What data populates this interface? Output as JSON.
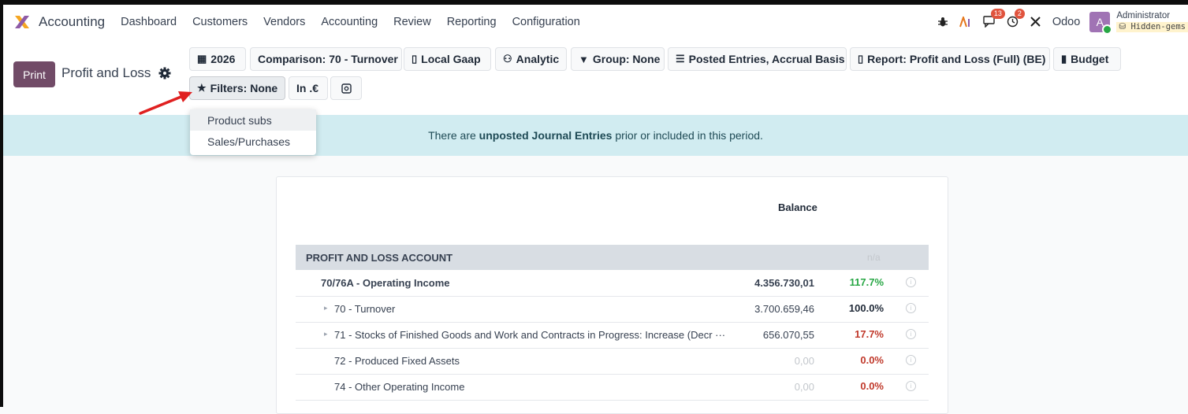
{
  "navbar": {
    "app_name": "Accounting",
    "menu": [
      "Dashboard",
      "Customers",
      "Vendors",
      "Accounting",
      "Review",
      "Reporting",
      "Configuration"
    ],
    "messages_count": "13",
    "activities_count": "2",
    "company": "Odoo",
    "user_initial": "A",
    "user_name": "Administrator",
    "database": "Hidden-gems"
  },
  "control": {
    "print_label": "Print",
    "title": "Profit and Loss",
    "filters": {
      "date": "2026",
      "comparison": "Comparison: 70 - Turnover",
      "local_gaap": "Local Gaap",
      "analytic": "Analytic",
      "group": "Group: None",
      "entries": "Posted Entries, Accrual Basis",
      "report": "Report: Profit and Loss (Full) (BE)",
      "budget": "Budget",
      "filters": "Filters: None",
      "rounding": "In .€"
    },
    "dropdown_items": [
      "Product subs",
      "Sales/Purchases"
    ]
  },
  "banner": {
    "prefix": "There are ",
    "link": "unposted Journal Entries",
    "suffix": " prior or included in this period."
  },
  "report": {
    "column_header": "Balance",
    "section_label": "PROFIT AND LOSS ACCOUNT",
    "section_extra": "n/a",
    "rows": [
      {
        "label": "70/76A - Operating Income",
        "balance": "4.356.730,01",
        "pct": "117.7%"
      },
      {
        "label": "70 - Turnover",
        "balance": "3.700.659,46",
        "pct": "100.0%"
      },
      {
        "label": "71 - Stocks of Finished Goods and Work and Contracts in Progress: Increase (Decr ···",
        "balance": "656.070,55",
        "pct": "17.7%"
      },
      {
        "label": "72 - Produced Fixed Assets",
        "balance": "0,00",
        "pct": "0.0%"
      },
      {
        "label": "74 - Other Operating Income",
        "balance": "0,00",
        "pct": "0.0%"
      }
    ]
  },
  "colors": {
    "primary": "#714b67",
    "banner_bg": "#d1ecf1",
    "positive": "#28a745",
    "negative": "#c0392b",
    "annotation_arrow": "#e02020"
  }
}
